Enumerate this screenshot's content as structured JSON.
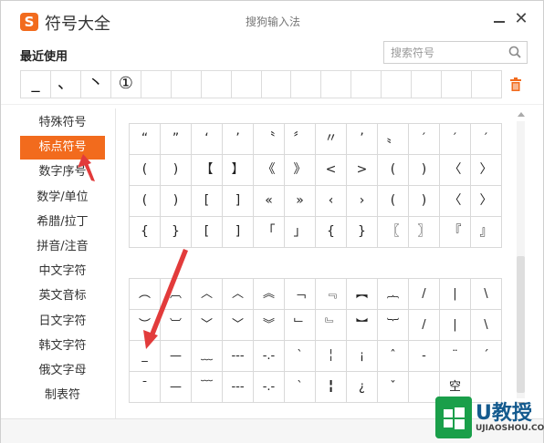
{
  "window": {
    "app_title": "符号大全",
    "ime_title": "搜狗输入法",
    "logo_glyph": "S",
    "close_glyph": "✕",
    "accent_color": "#f26b1d"
  },
  "recent": {
    "label": "最近使用",
    "cells": [
      "_",
      "、",
      "丶",
      "①",
      "",
      "",
      "",
      "",
      "",
      "",
      "",
      "",
      "",
      "",
      "",
      ""
    ]
  },
  "search": {
    "placeholder": "搜索符号",
    "icon": "search-icon"
  },
  "sidebar": {
    "items": [
      {
        "label": "特殊符号"
      },
      {
        "label": "标点符号",
        "active": true
      },
      {
        "label": "数字序号"
      },
      {
        "label": "数学/单位"
      },
      {
        "label": "希腊/拉丁"
      },
      {
        "label": "拼音/注音"
      },
      {
        "label": "中文字符"
      },
      {
        "label": "英文音标"
      },
      {
        "label": "日文字符"
      },
      {
        "label": "韩文字符"
      },
      {
        "label": "俄文字母"
      },
      {
        "label": "制表符"
      }
    ]
  },
  "punct_grid": [
    [
      "“",
      "”",
      "‘",
      "’",
      "〝",
      "〞",
      "〃",
      "’",
      "〟",
      "′",
      "′",
      "′"
    ],
    [
      "(",
      ")",
      "【",
      "】",
      "《",
      "》",
      "<",
      ">",
      "(",
      ")",
      "〈",
      "〉"
    ],
    [
      "(",
      ")",
      "[",
      "]",
      "«",
      "»",
      "‹",
      "›",
      "(",
      ")",
      "〈",
      "〉"
    ],
    [
      "{",
      "}",
      "[",
      "]",
      "「",
      "」",
      "{",
      "}",
      "〖",
      "〗",
      "『",
      "』"
    ]
  ],
  "line_grid": [
    [
      "︵",
      "︹",
      "︿",
      "︿",
      "︽",
      "﹁",
      "﹃",
      "︻",
      "︷",
      "/",
      "|",
      "\\"
    ],
    [
      "︶",
      "︺",
      "﹀",
      "﹀",
      "︾",
      "﹂",
      "﹄",
      "︼",
      "︸",
      "/",
      "|",
      "\\"
    ],
    [
      "_",
      "—",
      "﹏",
      "---",
      "-.-",
      "ˋ",
      "╎",
      "¡",
      "ˆ",
      "-",
      "¨",
      "ˊ"
    ],
    [
      "¯",
      "—",
      "﹋",
      "---",
      "-.-",
      "ˋ",
      "╏",
      "¿",
      "ˇ",
      "",
      "空",
      ""
    ]
  ],
  "watermark": {
    "brand": "U教授",
    "url": "UJIAOSHOU.COM"
  }
}
